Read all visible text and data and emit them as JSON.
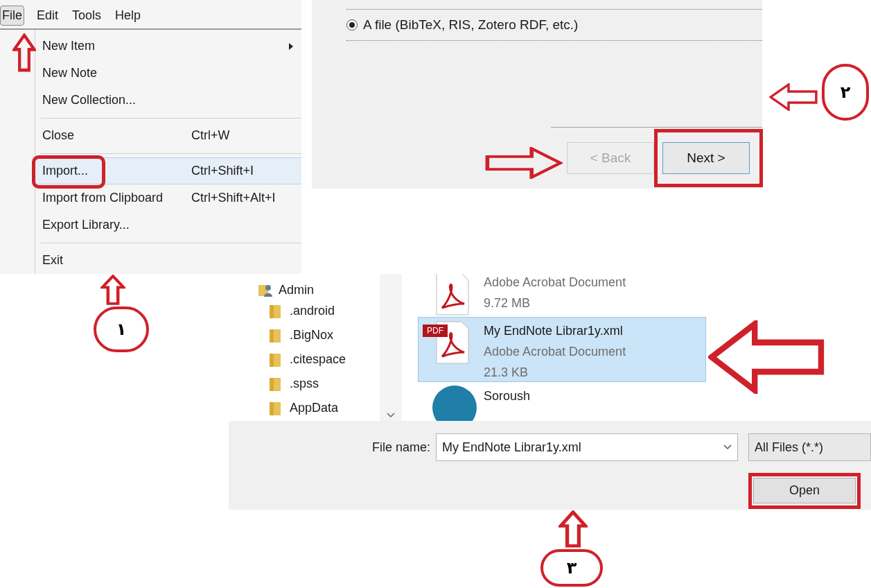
{
  "menu": {
    "menubar": [
      {
        "label": "File",
        "selected": true
      },
      {
        "label": "Edit",
        "selected": false
      },
      {
        "label": "Tools",
        "selected": false
      },
      {
        "label": "Help",
        "selected": false
      }
    ],
    "items": [
      {
        "kind": "item",
        "label": "New Item",
        "submenu": true,
        "selected": false
      },
      {
        "kind": "item",
        "label": "New Note",
        "submenu": false,
        "selected": false
      },
      {
        "kind": "item",
        "label": "New Collection...",
        "submenu": false,
        "selected": false
      },
      {
        "kind": "separator"
      },
      {
        "kind": "item",
        "label": "Close",
        "shortcut": "Ctrl+W",
        "submenu": false,
        "selected": false
      },
      {
        "kind": "separator"
      },
      {
        "kind": "item",
        "label": "Import...",
        "shortcut": "Ctrl+Shift+I",
        "submenu": false,
        "selected": true
      },
      {
        "kind": "item",
        "label": "Import from Clipboard",
        "shortcut": "Ctrl+Shift+Alt+I",
        "submenu": false,
        "selected": false
      },
      {
        "kind": "item",
        "label": "Export Library...",
        "submenu": false,
        "selected": false
      },
      {
        "kind": "separator"
      },
      {
        "kind": "item",
        "label": "Exit",
        "submenu": false,
        "selected": false
      }
    ]
  },
  "import_dialog": {
    "options": [
      {
        "label": "A file (BibTeX, RIS, Zotero RDF, etc.)",
        "selected": true
      }
    ],
    "buttons": [
      {
        "label": "< Back",
        "disabled": true
      },
      {
        "label": "Next >",
        "disabled": false
      }
    ]
  },
  "file_dialog": {
    "nav_tree": {
      "label": "Admin",
      "children": [
        {
          "label": ".android"
        },
        {
          "label": ".BigNox"
        },
        {
          "label": ".citespace"
        },
        {
          "label": ".spss"
        },
        {
          "label": "AppData"
        }
      ]
    },
    "files": [
      {
        "kind": "pdf",
        "type": "Adobe Acrobat Document",
        "size": "9.72 MB",
        "selected": false
      },
      {
        "kind": "pdf",
        "badge": "PDF",
        "name": "My EndNote Librar1y.xml",
        "type": "Adobe Acrobat Document",
        "size": "21.3 KB",
        "selected": true
      },
      {
        "kind": "app",
        "name": "Soroush",
        "selected": false
      }
    ],
    "file_name": {
      "label": "File name:",
      "value": "My EndNote Librar1y.xml"
    },
    "file_type": {
      "value": "All Files (*.*)"
    },
    "buttons": [
      "Open"
    ]
  },
  "annotations": [
    {
      "label": "۱"
    },
    {
      "label": "۲"
    },
    {
      "label": "۳"
    }
  ]
}
